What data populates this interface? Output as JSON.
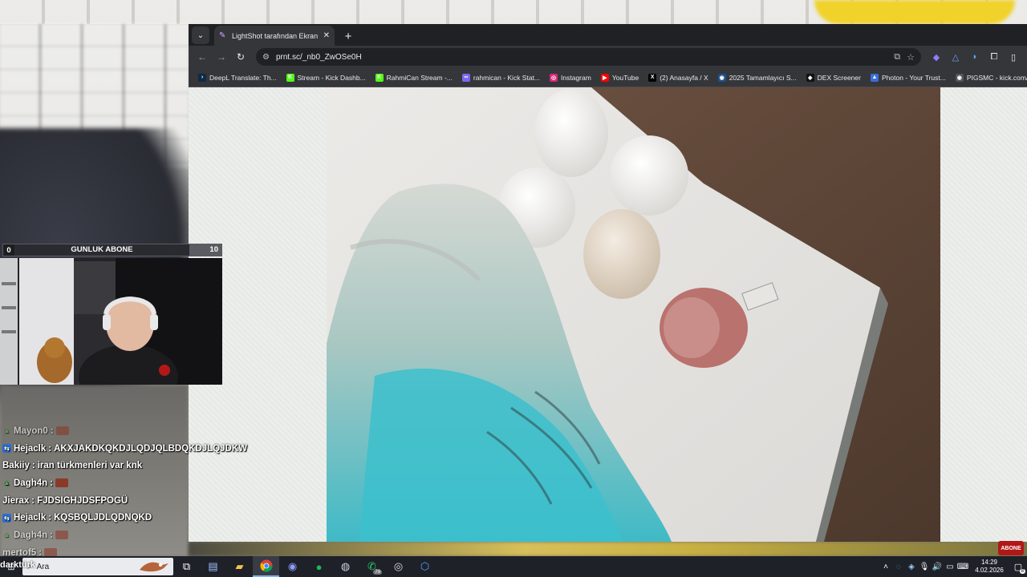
{
  "browser": {
    "tab_title": "LightShot tarafından Ekran Gör...",
    "url": "prnt.sc/_nb0_ZwOSe0H",
    "bookmarks": [
      {
        "label": "DeepL Translate: Th...",
        "icon": "deepl-icon",
        "color": "#0f2b46",
        "glyph": "›"
      },
      {
        "label": "Stream - Kick Dashb...",
        "icon": "kick-icon",
        "color": "#53fc18",
        "glyph": "K"
      },
      {
        "label": "RahmiCan Stream -...",
        "icon": "kick-icon",
        "color": "#53fc18",
        "glyph": "K"
      },
      {
        "label": "rahmican - Kick Stat...",
        "icon": "link-icon",
        "color": "#7b68ee",
        "glyph": "∞"
      },
      {
        "label": "Instagram",
        "icon": "instagram-icon",
        "color": "#d62976",
        "glyph": "◎"
      },
      {
        "label": "YouTube",
        "icon": "youtube-icon",
        "color": "#ff0000",
        "glyph": "▶"
      },
      {
        "label": "(2) Anasayfa / X",
        "icon": "x-icon",
        "color": "#000000",
        "glyph": "X"
      },
      {
        "label": "2025 Tamamlayıcı S...",
        "icon": "globe-icon",
        "color": "#1f4f8f",
        "glyph": "◉"
      },
      {
        "label": "DEX Screener",
        "icon": "dex-icon",
        "color": "#111111",
        "glyph": "◆"
      },
      {
        "label": "Photon - Your Trust...",
        "icon": "photon-icon",
        "color": "#3a6fd8",
        "glyph": "▲"
      },
      {
        "label": "PIGSMC - kick.com/...",
        "icon": "globe-icon",
        "color": "#555555",
        "glyph": "◉"
      }
    ]
  },
  "overlay": {
    "sub_goal_left": "0",
    "sub_goal_label": "GUNLUK ABONE",
    "sub_goal_right": "10"
  },
  "chat": [
    {
      "user": "Mayon0",
      "sep": " :",
      "msg": "",
      "badge": "mod",
      "emote": true,
      "faded": true
    },
    {
      "user": "Hejaclk",
      "sep": " :",
      "msg": " AKXJAKDKQKDJLQDJQLBDQKDJLQJDKW",
      "badge": "sub",
      "emote": false,
      "faded": false
    },
    {
      "user": "Bakiiy",
      "sep": " :",
      "msg": " iran türkmenleri var knk",
      "badge": "",
      "emote": false,
      "faded": false
    },
    {
      "user": "Dagh4n",
      "sep": " :",
      "msg": "",
      "badge": "mod",
      "emote": true,
      "faded": false
    },
    {
      "user": "Jierax",
      "sep": " :",
      "msg": " FJDSIGHJDSFPOGÜ",
      "badge": "",
      "emote": false,
      "faded": false
    },
    {
      "user": "Hejaclk",
      "sep": " :",
      "msg": " KQSBQLJDLQDNQKD",
      "badge": "sub",
      "emote": false,
      "faded": false
    },
    {
      "user": "Dagh4n",
      "sep": " :",
      "msg": "",
      "badge": "mod",
      "emote": true,
      "faded": true
    },
    {
      "user": "mertof5",
      "sep": " :",
      "msg": "",
      "badge": "",
      "emote": true,
      "faded": true
    }
  ],
  "taskbar": {
    "search_placeholder": "Ara",
    "overlay_name": "darktürk",
    "time": "14:29",
    "date": "4.02.2026",
    "whatsapp_count": "79",
    "notif_count": "8",
    "abone_logo": "ABONE"
  },
  "colors": {
    "chrome_dark": "#202124",
    "chrome_toolbar": "#35363a",
    "taskbar": "#1f2129",
    "sub_badge": "#2a6fd6",
    "mod_badge": "#3ec43e"
  }
}
